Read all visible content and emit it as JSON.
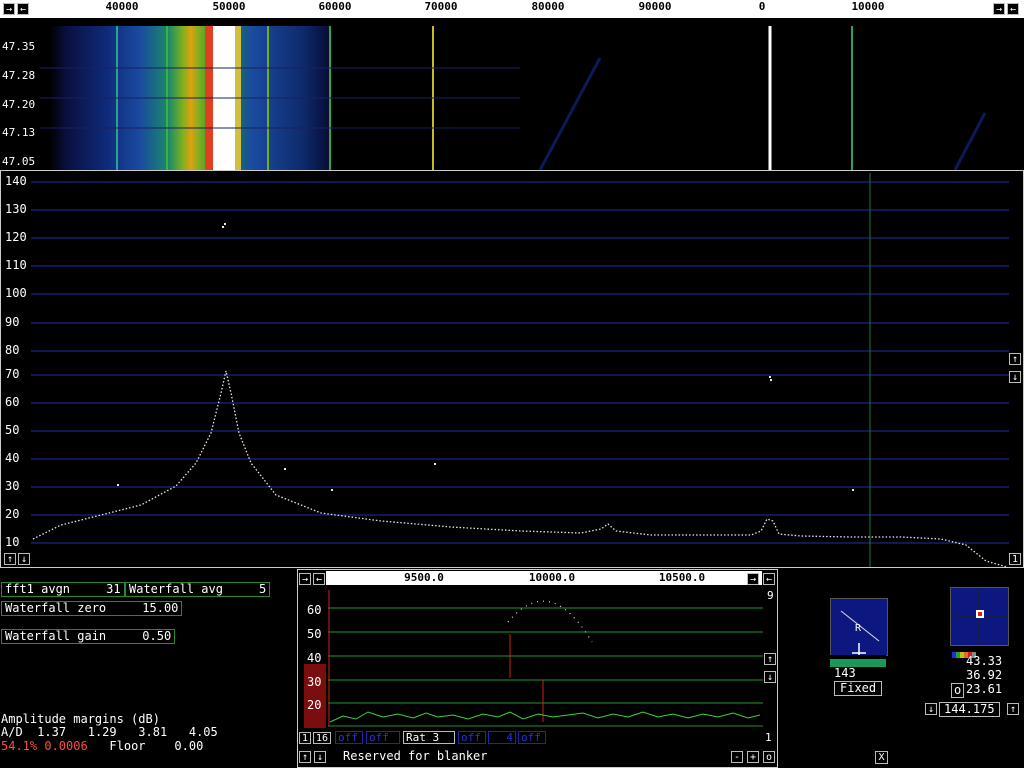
{
  "top_scale": {
    "labels": [
      "40000",
      "50000",
      "60000",
      "70000",
      "80000",
      "90000",
      "0",
      "10000"
    ]
  },
  "waterfall": {
    "time_labels": [
      "47.35",
      "47.28",
      "47.20",
      "47.13",
      "47.05"
    ]
  },
  "spectrum": {
    "y_labels": [
      "140",
      "130",
      "120",
      "110",
      "100",
      "90",
      "80",
      "70",
      "60",
      "50",
      "40",
      "30",
      "20",
      "10"
    ]
  },
  "params": {
    "fft1_avgn_label": "fft1 avgn",
    "fft1_avgn_value": "31",
    "wf_avg_label": "Waterfall avg",
    "wf_avg_value": "5",
    "wf_zero_label": "Waterfall zero",
    "wf_zero_value": "15.00",
    "wf_gain_label": "Waterfall gain",
    "wf_gain_value": "0.50"
  },
  "amplitude": {
    "title": "Amplitude margins (dB)",
    "ad_label": "A/D",
    "ad_values": "1.37   1.29   3.81   4.05",
    "cpu_line": "54.1% 0.0006",
    "floor_label": "Floor",
    "floor_value": "0.00"
  },
  "baseband": {
    "freq_labels": [
      "9500.0",
      "10000.0",
      "10500.0"
    ],
    "y_labels": [
      "60",
      "50",
      "40",
      "30",
      "20"
    ],
    "corner_top": "9",
    "corner_bottom": "1",
    "one_label": "1",
    "sixteen_label": "16",
    "off1": "off",
    "off2": "off",
    "rat_label": "Rat",
    "rat_value": "3",
    "off3": "off",
    "off4_value": "4",
    "off5": "off",
    "blanker_text": "Reserved for blanker",
    "minus": "-",
    "plus": "+",
    "zero": "o"
  },
  "smeter": {
    "label_r": "R",
    "value": "143",
    "mode": "Fixed"
  },
  "pol": {
    "v1": "43.33",
    "v2": "36.92",
    "o_label": "o",
    "v3": "23.61",
    "freq": "144.175"
  },
  "close_label": "X",
  "colors": {
    "grid_blue": "#1a2fa8",
    "grid_green": "#1f9a1f",
    "marker_red": "#d02020"
  }
}
